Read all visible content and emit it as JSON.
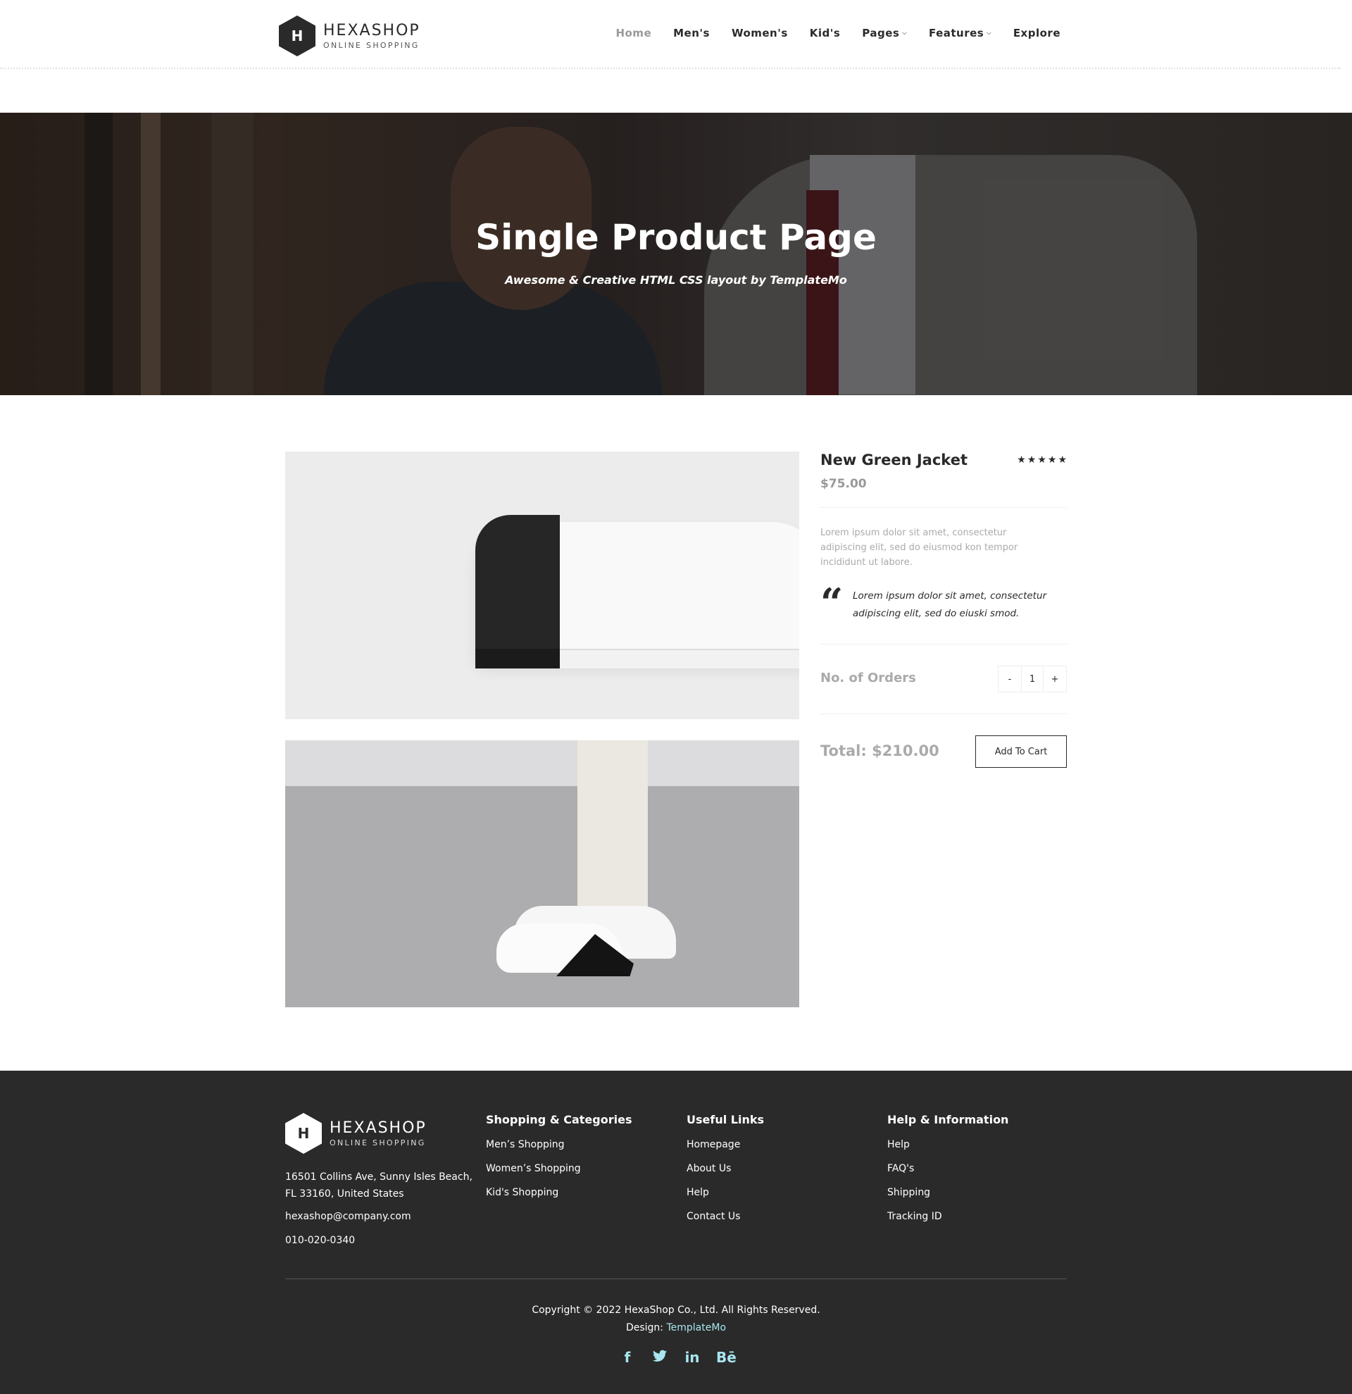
{
  "header": {
    "logo_mark": "H",
    "logo_name": "HEXASHOP",
    "logo_sub": "ONLINE SHOPPING",
    "nav": [
      {
        "label": "Home",
        "active": true
      },
      {
        "label": "Men's"
      },
      {
        "label": "Women's"
      },
      {
        "label": "Kid's"
      },
      {
        "label": "Pages",
        "dropdown": true
      },
      {
        "label": "Features",
        "dropdown": true
      },
      {
        "label": "Explore"
      }
    ]
  },
  "hero": {
    "title": "Single Product Page",
    "subtitle": "Awesome & Creative HTML CSS layout by TemplateMo"
  },
  "product": {
    "name": "New Green Jacket",
    "rating": 5,
    "price": "$75.00",
    "description": "Lorem ipsum dolor sit amet, consectetur adipiscing elit, sed do eiusmod kon tempor incididunt ut labore.",
    "quote": "Lorem ipsum dolor sit amet, consectetur adipiscing elit, sed do eiuski smod.",
    "orders_label": "No. of Orders",
    "qty_minus": "-",
    "qty_value": "1",
    "qty_plus": "+",
    "total": "Total: $210.00",
    "add_to_cart": "Add To Cart"
  },
  "footer": {
    "logo_mark": "H",
    "logo_name": "HEXASHOP",
    "logo_sub": "ONLINE SHOPPING",
    "address": "16501 Collins Ave, Sunny Isles Beach, FL 33160, United States",
    "email": "hexashop@company.com",
    "phone": "010-020-0340",
    "shopping": {
      "title": "Shopping & Categories",
      "items": [
        "Men’s Shopping",
        "Women’s Shopping",
        "Kid's Shopping"
      ]
    },
    "useful": {
      "title": "Useful Links",
      "items": [
        "Homepage",
        "About Us",
        "Help",
        "Contact Us"
      ]
    },
    "help": {
      "title": "Help & Information",
      "items": [
        "Help",
        "FAQ's",
        "Shipping",
        "Tracking ID"
      ]
    },
    "copyright": "Copyright © 2022 HexaShop Co., Ltd. All Rights Reserved.",
    "design_label": "Design:",
    "design_link": "TemplateMo",
    "social": [
      {
        "icon": "facebook-icon",
        "glyph": "f"
      },
      {
        "icon": "twitter-icon",
        "glyph": "🐦"
      },
      {
        "icon": "linkedin-icon",
        "glyph": "in"
      },
      {
        "icon": "behance-icon",
        "glyph": "Bē"
      }
    ]
  },
  "colors": {
    "dark": "#2a2a2a",
    "muted": "#aaaaaa",
    "accent": "#a8e6ef"
  }
}
